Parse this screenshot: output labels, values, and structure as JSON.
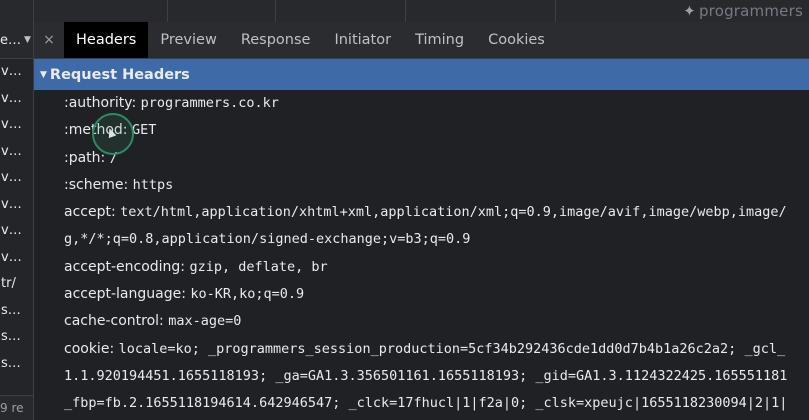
{
  "brand": {
    "watermark": "programmers"
  },
  "left_column": {
    "header": "e…",
    "items": [
      "v…",
      "v…",
      "v…",
      "v…",
      "v…",
      "v…",
      "v…",
      "v…",
      "tr/",
      "s…",
      "s…",
      "s…"
    ],
    "footer": "9 re"
  },
  "tabs": {
    "close_label": "×",
    "items": [
      "Headers",
      "Preview",
      "Response",
      "Initiator",
      "Timing",
      "Cookies"
    ],
    "active": "Headers"
  },
  "request_headers": {
    "title": "Request Headers",
    "rows": [
      {
        "name": ":authority:",
        "value": "programmers.co.kr"
      },
      {
        "name": ":method:",
        "value": "GET"
      },
      {
        "name": ":path:",
        "value": "/"
      },
      {
        "name": ":scheme:",
        "value": "https"
      },
      {
        "name": "accept:",
        "value": "text/html,application/xhtml+xml,application/xml;q=0.9,image/avif,image/webp,image/"
      },
      {
        "name": "",
        "value": "g,*/*;q=0.8,application/signed-exchange;v=b3;q=0.9"
      },
      {
        "name": "accept-encoding:",
        "value": "gzip, deflate, br"
      },
      {
        "name": "accept-language:",
        "value": "ko-KR,ko;q=0.9"
      },
      {
        "name": "cache-control:",
        "value": "max-age=0"
      },
      {
        "name": "cookie:",
        "value": "locale=ko; _programmers_session_production=5cf34b292436cde1dd0d7b4b1a26c2a2; _gcl_"
      },
      {
        "name": "",
        "value": "1.1.920194451.1655118193; _ga=GA1.3.356501161.1655118193; _gid=GA1.3.1124322425.165551181"
      },
      {
        "name": "",
        "value": "_fbp=fb.2.1655118194614.642946547; _clck=17fhucl|1|f2a|0; _clsk=xpeujc|1655118230094|2|1|"
      }
    ]
  },
  "colors": {
    "section_header_bg": "#3f6aa8",
    "cursor_ring": "#2e8a64",
    "active_tab_bg": "#000000"
  }
}
